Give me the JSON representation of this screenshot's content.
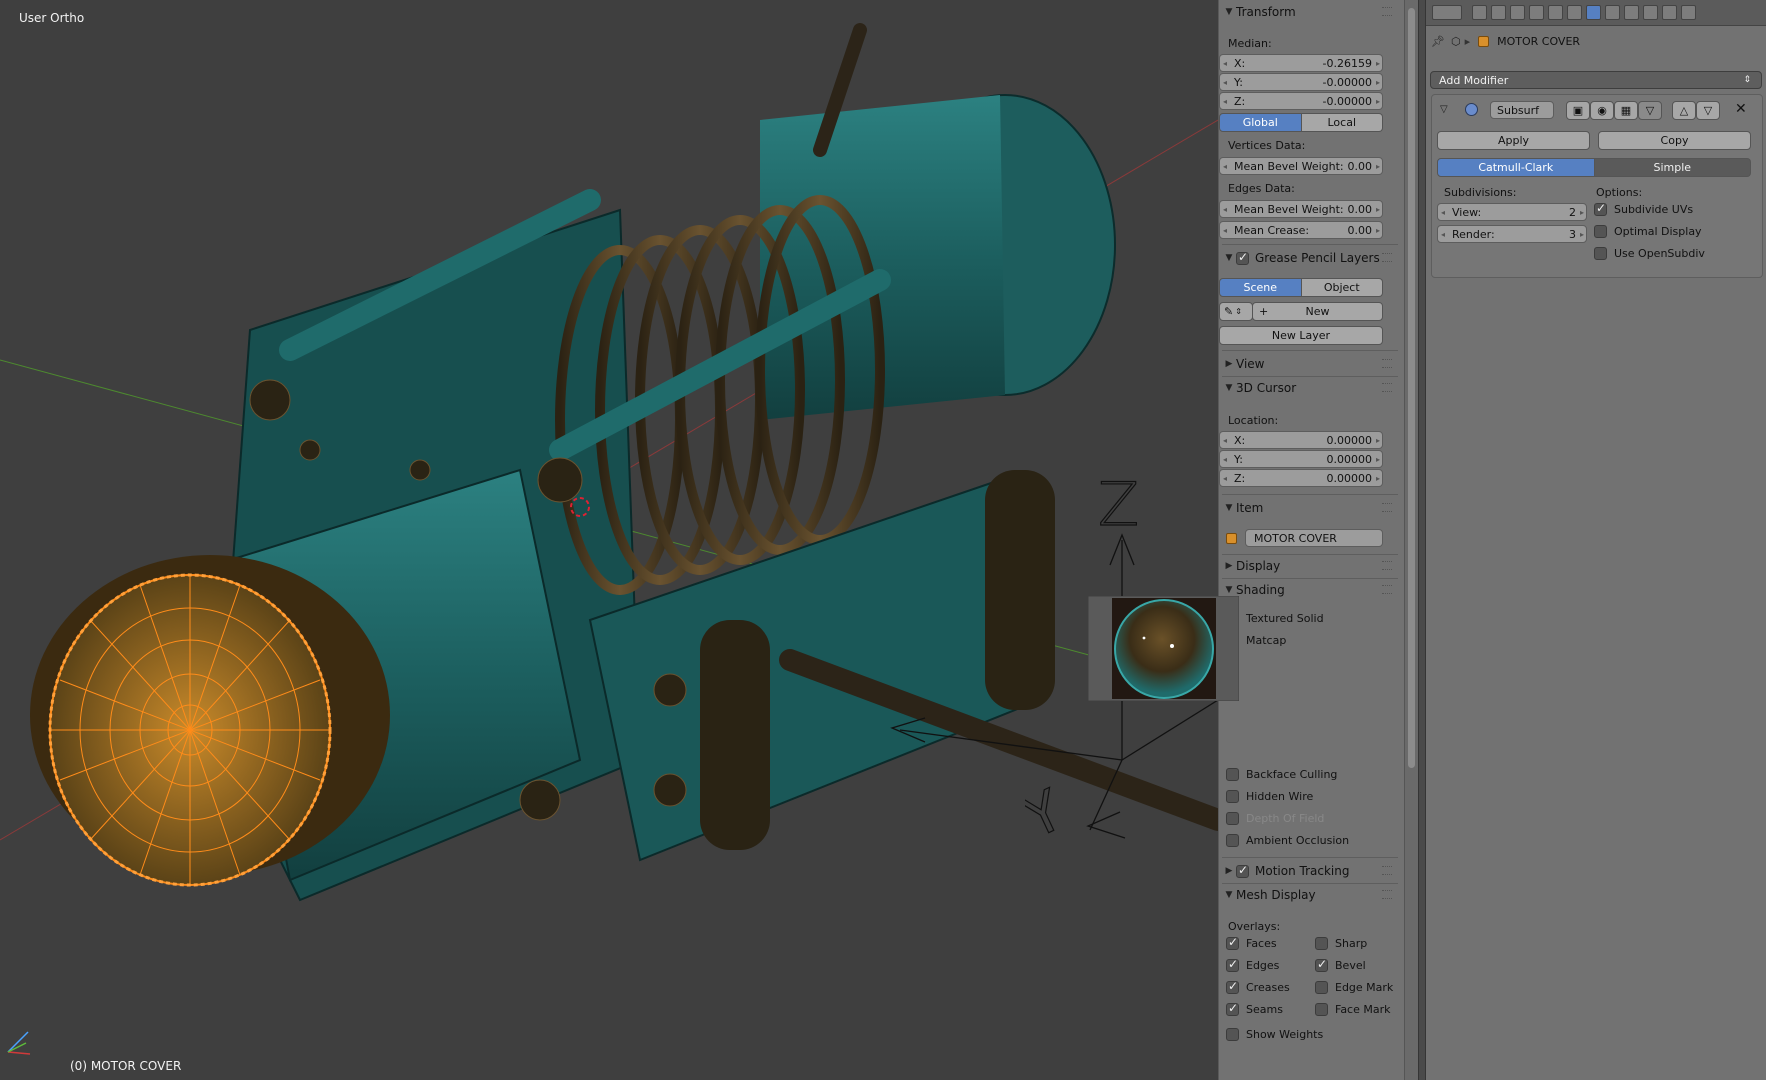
{
  "viewport": {
    "title": "User Ortho",
    "object_label": "(0) MOTOR COVER",
    "axis_labels": {
      "z": "Z",
      "y": "Y"
    },
    "colors": {
      "background": "#3f3f3f",
      "object": "#1f6b6b",
      "selected": "#ff8c1a"
    }
  },
  "npanel": {
    "transform": {
      "header": "Transform",
      "median_label": "Median:",
      "x": {
        "k": "X:",
        "v": "-0.26159"
      },
      "y": {
        "k": "Y:",
        "v": "-0.00000"
      },
      "z": {
        "k": "Z:",
        "v": "-0.00000"
      },
      "global_label": "Global",
      "local_label": "Local",
      "vertices_label": "Vertices Data:",
      "vert_bevel": {
        "k": "Mean Bevel Weight:",
        "v": "0.00"
      },
      "edges_label": "Edges Data:",
      "edge_bevel": {
        "k": "Mean Bevel Weight:",
        "v": "0.00"
      },
      "edge_crease": {
        "k": "Mean Crease:",
        "v": "0.00"
      }
    },
    "grease_pencil": {
      "header": "Grease Pencil Layers",
      "scene_label": "Scene",
      "object_label": "Object",
      "new_label": "New",
      "new_layer_label": "New Layer"
    },
    "view": {
      "header": "View"
    },
    "cursor": {
      "header": "3D Cursor",
      "location_label": "Location:",
      "x": {
        "k": "X:",
        "v": "0.00000"
      },
      "y": {
        "k": "Y:",
        "v": "0.00000"
      },
      "z": {
        "k": "Z:",
        "v": "0.00000"
      }
    },
    "item": {
      "header": "Item",
      "name": "MOTOR COVER"
    },
    "display": {
      "header": "Display"
    },
    "shading": {
      "header": "Shading",
      "textured_solid": "Textured Solid",
      "matcap": "Matcap",
      "backface_culling": "Backface Culling",
      "hidden_wire": "Hidden Wire",
      "depth_of_field": "Depth Of Field",
      "ambient_occlusion": "Ambient Occlusion"
    },
    "motion_tracking": {
      "header": "Motion Tracking"
    },
    "mesh_display": {
      "header": "Mesh Display",
      "overlays_label": "Overlays:",
      "faces": "Faces",
      "edges": "Edges",
      "creases": "Creases",
      "seams": "Seams",
      "sharp": "Sharp",
      "bevel": "Bevel",
      "edge_mark": "Edge Mark",
      "face_mark": "Face Mark",
      "show_weights": "Show Weights"
    }
  },
  "props": {
    "object_name": "MOTOR COVER",
    "add_modifier": "Add Modifier",
    "modifier": {
      "name": "Subsurf",
      "apply_label": "Apply",
      "copy_label": "Copy",
      "catmull_label": "Catmull-Clark",
      "simple_label": "Simple",
      "subdivisions_label": "Subdivisions:",
      "options_label": "Options:",
      "view": {
        "k": "View:",
        "v": "2"
      },
      "render": {
        "k": "Render:",
        "v": "3"
      },
      "subdivide_uvs": "Subdivide UVs",
      "optimal_display": "Optimal Display",
      "use_opensubdiv": "Use OpenSubdiv"
    }
  }
}
